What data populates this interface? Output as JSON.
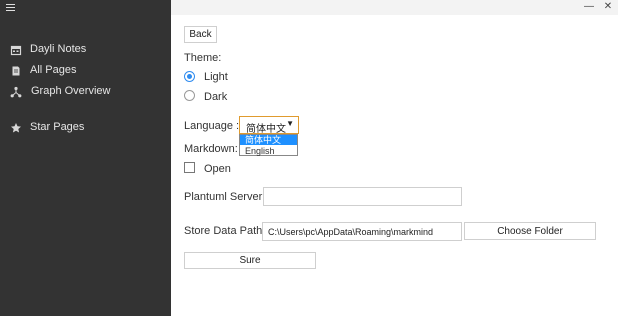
{
  "sidebar": {
    "menu_icon": "hamburger-icon",
    "items": [
      {
        "label": "Dayli Notes",
        "icon": "calendar-icon"
      },
      {
        "label": "All Pages",
        "icon": "document-icon"
      },
      {
        "label": "Graph Overview",
        "icon": "graph-icon"
      },
      {
        "label": "Star Pages",
        "icon": "star-icon"
      }
    ]
  },
  "titlebar": {
    "minimize": "—",
    "close": "✕"
  },
  "settings": {
    "back_label": "Back",
    "theme_label": "Theme:",
    "theme_options": [
      "Light",
      "Dark"
    ],
    "theme_selected": "Light",
    "language_label": "Language :",
    "language_value": "简体中文",
    "language_options": [
      "简体中文",
      "English"
    ],
    "markdown_label": "Markdown:",
    "open_label": "Open",
    "open_checked": false,
    "plantuml_label": "Plantuml Server :",
    "plantuml_value": "",
    "store_label": "Store Data Path :",
    "store_value": "C:\\Users\\pc\\AppData\\Roaming\\markmind",
    "choose_folder_label": "Choose Folder",
    "sure_label": "Sure"
  },
  "colors": {
    "sidebar_bg": "#333333",
    "accent": "#2f8cf0",
    "select_border": "#e09b2e",
    "dropdown_highlight": "#1e90ff"
  }
}
